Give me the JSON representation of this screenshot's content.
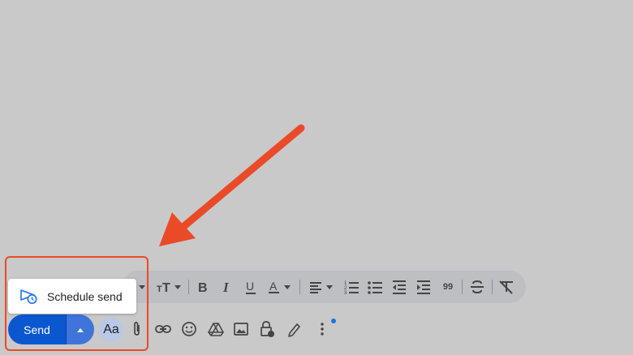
{
  "popup": {
    "label": "Schedule send"
  },
  "send": {
    "label": "Send"
  },
  "toolbar": {
    "formatting_label": "Aa"
  },
  "formatting_bar": {
    "quote_glyph": "99"
  },
  "colors": {
    "accent": "#0b57d0",
    "annotation": "#ea4a28",
    "background": "#c9c9c9"
  },
  "icons": [
    "text-size-icon",
    "bold-icon",
    "italic-icon",
    "underline-icon",
    "text-color-icon",
    "align-icon",
    "numbered-list-icon",
    "bulleted-list-icon",
    "indent-less-icon",
    "indent-more-icon",
    "quote-icon",
    "strikethrough-icon",
    "remove-formatting-icon",
    "attach-icon",
    "link-icon",
    "emoji-icon",
    "drive-icon",
    "photo-icon",
    "confidential-icon",
    "signature-icon",
    "more-options-icon",
    "schedule-send-icon"
  ]
}
